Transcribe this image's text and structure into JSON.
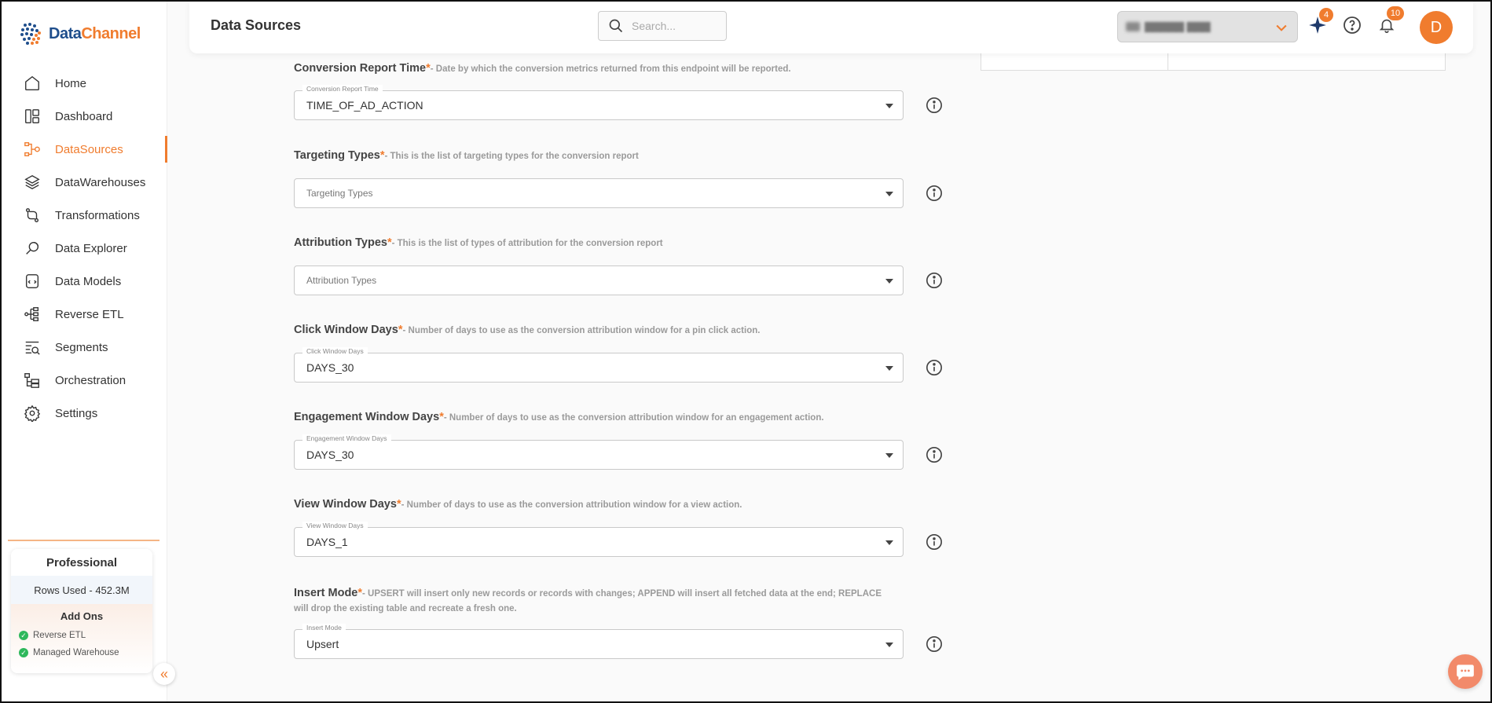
{
  "app": {
    "brand_part1": "Data",
    "brand_part2": "Channel"
  },
  "colors": {
    "accent": "#f07c2e",
    "brand_blue": "#1f4e8c",
    "success": "#2eb85c"
  },
  "sidebar": {
    "items": [
      {
        "label": "Home",
        "icon": "home-icon"
      },
      {
        "label": "Dashboard",
        "icon": "dashboard-icon"
      },
      {
        "label": "DataSources",
        "icon": "datasources-icon",
        "active": true
      },
      {
        "label": "DataWarehouses",
        "icon": "layers-icon"
      },
      {
        "label": "Transformations",
        "icon": "transform-icon"
      },
      {
        "label": "Data Explorer",
        "icon": "explorer-icon"
      },
      {
        "label": "Data Models",
        "icon": "model-icon"
      },
      {
        "label": "Reverse ETL",
        "icon": "reverse-etl-icon"
      },
      {
        "label": "Segments",
        "icon": "segments-icon"
      },
      {
        "label": "Orchestration",
        "icon": "orchestration-icon"
      },
      {
        "label": "Settings",
        "icon": "settings-icon"
      }
    ],
    "plan": {
      "name": "Professional",
      "rows_used": "Rows Used - 452.3M",
      "addons_title": "Add Ons",
      "addons": [
        "Reverse ETL",
        "Managed Warehouse"
      ]
    }
  },
  "header": {
    "title": "Data Sources",
    "search_placeholder": "Search...",
    "ai_badge": "4",
    "notif_badge": "10",
    "avatar_letter": "D"
  },
  "form": {
    "fields": [
      {
        "label": "Conversion Report Time",
        "desc": "- Date by which the conversion metrics returned from this endpoint will be reported.",
        "float_label": "Conversion Report Time",
        "value": "TIME_OF_AD_ACTION",
        "placeholder": ""
      },
      {
        "label": "Targeting Types",
        "desc": "- This is the list of targeting types for the conversion report",
        "float_label": "",
        "value": "",
        "placeholder": "Targeting Types"
      },
      {
        "label": "Attribution Types",
        "desc": "- This is the list of types of attribution for the conversion report",
        "float_label": "",
        "value": "",
        "placeholder": "Attribution Types"
      },
      {
        "label": "Click Window Days",
        "desc": "- Number of days to use as the conversion attribution window for a pin click action.",
        "float_label": "Click Window Days",
        "value": "DAYS_30",
        "placeholder": ""
      },
      {
        "label": "Engagement Window Days",
        "desc": "- Number of days to use as the conversion attribution window for an engagement action.",
        "float_label": "Engagement Window Days",
        "value": "DAYS_30",
        "placeholder": ""
      },
      {
        "label": "View Window Days",
        "desc": "- Number of days to use as the conversion attribution window for a view action.",
        "float_label": "View Window Days",
        "value": "DAYS_1",
        "placeholder": ""
      },
      {
        "label": "Insert Mode",
        "desc": "- UPSERT will insert only new records or records with changes; APPEND will insert all fetched data at the end; REPLACE will drop the existing table and recreate a fresh one.",
        "float_label": "Insert Mode",
        "value": "Upsert",
        "placeholder": ""
      }
    ],
    "required_mark": "*"
  }
}
